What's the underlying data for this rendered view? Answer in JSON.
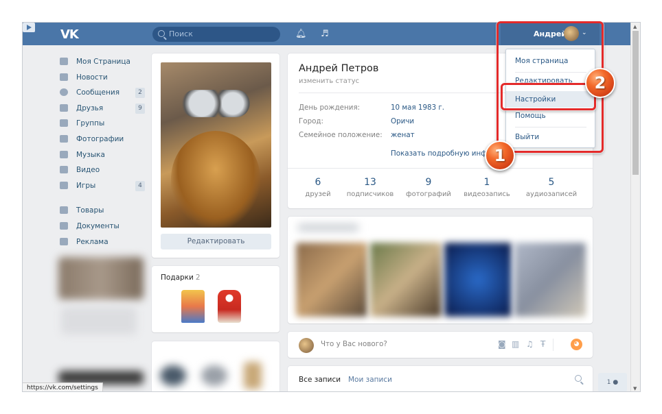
{
  "header": {
    "logo": "VK",
    "search_placeholder": "Поиск",
    "user_name": "Андрей",
    "chevron": "⌄"
  },
  "sidebar": {
    "items": [
      {
        "label": "Моя Страница",
        "badge": ""
      },
      {
        "label": "Новости",
        "badge": ""
      },
      {
        "label": "Сообщения",
        "badge": "2"
      },
      {
        "label": "Друзья",
        "badge": "9"
      },
      {
        "label": "Группы",
        "badge": ""
      },
      {
        "label": "Фотографии",
        "badge": ""
      },
      {
        "label": "Музыка",
        "badge": ""
      },
      {
        "label": "Видео",
        "badge": ""
      },
      {
        "label": "Игры",
        "badge": "4"
      }
    ],
    "secondary": [
      {
        "label": "Товары"
      },
      {
        "label": "Документы"
      },
      {
        "label": "Реклама"
      }
    ]
  },
  "photo_card": {
    "edit_label": "Редактировать"
  },
  "gifts": {
    "title": "Подарки",
    "count": "2"
  },
  "profile": {
    "full_name": "Андрей Петров",
    "status_prompt": "изменить статус",
    "fields": [
      {
        "label": "День рождения:",
        "value": "10 мая 1983 г."
      },
      {
        "label": "Город:",
        "value": "Оричи"
      },
      {
        "label": "Семейное положение:",
        "value": "женат"
      }
    ],
    "show_more": "Показать подробную инфор",
    "counters": [
      {
        "num": "6",
        "caption": "друзей"
      },
      {
        "num": "13",
        "caption": "подписчиков"
      },
      {
        "num": "9",
        "caption": "фотографий"
      },
      {
        "num": "1",
        "caption": "видеозапись"
      },
      {
        "num": "5",
        "caption": "аудиозаписей"
      }
    ]
  },
  "post_box": {
    "placeholder": "Что у Вас нового?"
  },
  "wall": {
    "tab_all": "Все записи",
    "tab_mine": "Мои записи"
  },
  "friends_online": "1",
  "status_bar_url": "https://vk.com/settings",
  "dropdown": {
    "items": [
      "Моя страница",
      "Редактировать",
      "Настройки",
      "Помощь",
      "Выйти"
    ]
  },
  "markers": {
    "first": "1",
    "second": "2"
  },
  "colors": {
    "header": "#4a76a8",
    "link": "#2a5885",
    "annotation_red": "#e42a2a",
    "marker_orange": "#f36a2a"
  }
}
